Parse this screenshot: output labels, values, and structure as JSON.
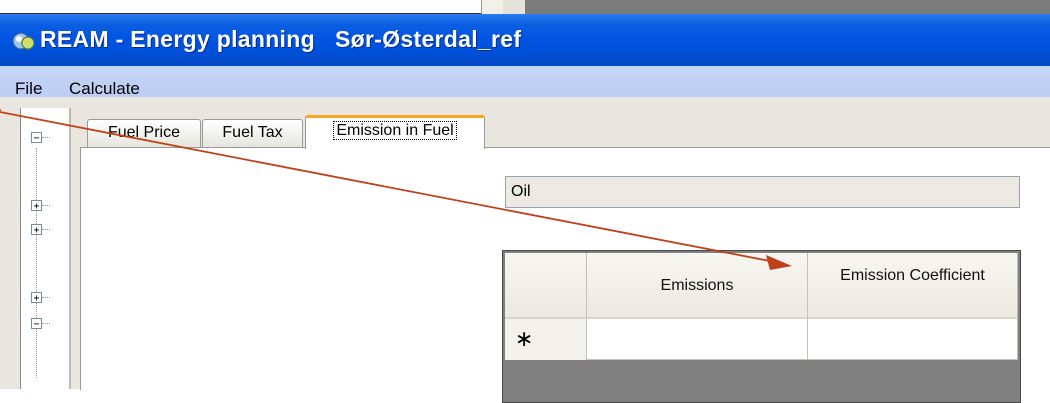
{
  "window": {
    "title": "REAM - Energy planning   Sør-Østerdal_ref"
  },
  "menu": {
    "items": [
      {
        "label": "File"
      },
      {
        "label": "Calculate"
      }
    ]
  },
  "tree": {
    "toggles": [
      "−",
      "+",
      "+",
      "+",
      "−"
    ]
  },
  "tabs": [
    {
      "label": "Fuel Price",
      "active": false
    },
    {
      "label": "Fuel Tax",
      "active": false
    },
    {
      "label": "Emission in Fuel",
      "active": true
    }
  ],
  "fuel": {
    "value": "Oil"
  },
  "grid": {
    "columns": [
      {
        "label": "Emissions"
      },
      {
        "label": "Emission Coefficient"
      }
    ],
    "new_row_marker": "∗"
  },
  "colors": {
    "titlebar": "#0054e3",
    "menubar": "#c1d2ee",
    "active_tab_accent": "#f5a623",
    "annotation_arrow": "#c0401a"
  }
}
